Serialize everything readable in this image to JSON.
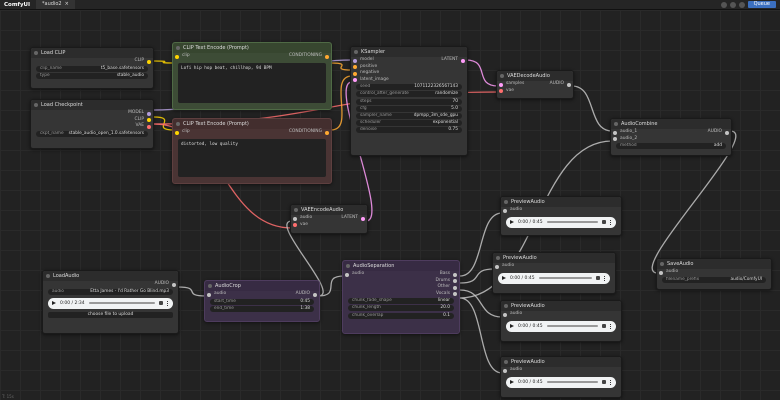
{
  "app": {
    "brand": "ComfyUI",
    "tab_label": "*audio2",
    "queue_label": "Queue"
  },
  "colors": {
    "model": "#b39ddb",
    "clip": "#ffd500",
    "conditioning": "#ffa931",
    "latent": "#ff9cf9",
    "vae": "#ff6e6e",
    "audio": "#c4c4c4",
    "int": "#7ec8e3"
  },
  "nodes": {
    "load_clip": {
      "title": "Load CLIP",
      "out_clip": "CLIP",
      "clip_name_label": "clip_name",
      "clip_name": "t5_base.safetensors",
      "type_label": "type",
      "type": "stable_audio"
    },
    "load_ckpt": {
      "title": "Load Checkpoint",
      "out_model": "MODEL",
      "out_clip": "CLIP",
      "out_vae": "VAE",
      "ckpt_label": "ckpt_name",
      "ckpt": "stable_audio_open_1.0.safetensors"
    },
    "clip_pos": {
      "title": "CLIP Text Encode (Prompt)",
      "in_clip": "clip",
      "out": "CONDITIONING",
      "text": "Lofi hip hop beat, chillhop, 94 BPM"
    },
    "clip_neg": {
      "title": "CLIP Text Encode (Prompt)",
      "in_clip": "clip",
      "out": "CONDITIONING",
      "text": "distorted, low quality"
    },
    "ksampler": {
      "title": "KSampler",
      "in_model": "model",
      "in_positive": "positive",
      "in_negative": "negative",
      "in_latent": "latent_image",
      "out": "LATENT",
      "widgets": [
        {
          "label": "seed",
          "value": "1071122326567143"
        },
        {
          "label": "control_after_generate",
          "value": "randomize"
        },
        {
          "label": "steps",
          "value": "70"
        },
        {
          "label": "cfg",
          "value": "5.0"
        },
        {
          "label": "sampler_name",
          "value": "dpmpp_3m_sde_gpu"
        },
        {
          "label": "scheduler",
          "value": "exponential"
        },
        {
          "label": "denoise",
          "value": "0.75"
        }
      ]
    },
    "vae_decode": {
      "title": "VAEDecodeAudio",
      "in_samples": "samples",
      "in_vae": "vae",
      "out": "AUDIO"
    },
    "vae_encode": {
      "title": "VAEEncodeAudio",
      "in_audio": "audio",
      "in_vae": "vae",
      "out": "LATENT"
    },
    "audio_combine": {
      "title": "AudioCombine",
      "in_a1": "audio_1",
      "in_a2": "audio_2",
      "out": "AUDIO",
      "method_label": "method",
      "method": "add"
    },
    "load_audio": {
      "title": "LoadAudio",
      "out": "AUDIO",
      "audio_label": "audio",
      "audio": "Etta James - I'd Rather Go Blind.mp3",
      "time": "0:00 / 2:34",
      "upload": "choose file to upload"
    },
    "audio_crop": {
      "title": "AudioCrop",
      "in_audio": "audio",
      "out": "AUDIO",
      "start_label": "start_time",
      "start": "0:45",
      "end_label": "end_time",
      "end": "1:38"
    },
    "separation": {
      "title": "AudioSeparation",
      "in_audio": "audio",
      "out_bass": "Bass",
      "out_drums": "Drums",
      "out_other": "Other",
      "out_vocals": "Vocals",
      "widgets": [
        {
          "label": "chunk_fade_shape",
          "value": "linear"
        },
        {
          "label": "chunk_length",
          "value": "20.0"
        },
        {
          "label": "chunk_overlap",
          "value": "0.1"
        }
      ]
    },
    "preview1": {
      "title": "PreviewAudio",
      "in_audio": "audio",
      "time": "0:00 / 0:45"
    },
    "preview2": {
      "title": "PreviewAudio",
      "in_audio": "audio",
      "time": "0:00 / 0:45"
    },
    "preview3": {
      "title": "PreviewAudio",
      "in_audio": "audio",
      "time": "0:00 / 0:45"
    },
    "preview4": {
      "title": "PreviewAudio",
      "in_audio": "audio",
      "time": "0:00 / 0:45"
    },
    "save_audio": {
      "title": "SaveAudio",
      "in_audio": "audio",
      "prefix_label": "filename_prefix",
      "prefix": "audio/ComfyUI"
    }
  },
  "footer": {
    "text": "T: 15s"
  }
}
